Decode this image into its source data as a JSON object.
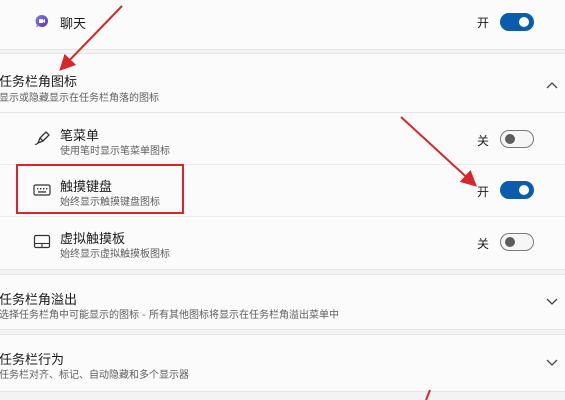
{
  "chat_row": {
    "title": "聊天",
    "state": "开",
    "toggle_on": true
  },
  "section_corner_icons": {
    "title": "任务栏角图标",
    "desc": "显示或隐藏显示在任务栏角落的图标",
    "items": [
      {
        "title": "笔菜单",
        "desc": "使用笔时显示笔菜单图标",
        "state": "关",
        "toggle_on": false,
        "icon": "pen-icon"
      },
      {
        "title": "触摸键盘",
        "desc": "始终显示触摸键盘图标",
        "state": "开",
        "toggle_on": true,
        "icon": "keyboard-icon"
      },
      {
        "title": "虚拟触摸板",
        "desc": "始终显示虚拟触摸板图标",
        "state": "关",
        "toggle_on": false,
        "icon": "touchpad-icon"
      }
    ]
  },
  "section_overflow": {
    "title": "任务栏角溢出",
    "desc": "选择任务栏角中可能显示的图标 - 所有其他图标将显示在任务栏角溢出菜单中"
  },
  "section_behavior": {
    "title": "任务栏行为",
    "desc": "任务栏对齐、标记、自动隐藏和多个显示器"
  },
  "colors": {
    "accent": "#0b5cad",
    "annotation_red": "#d7262c"
  }
}
